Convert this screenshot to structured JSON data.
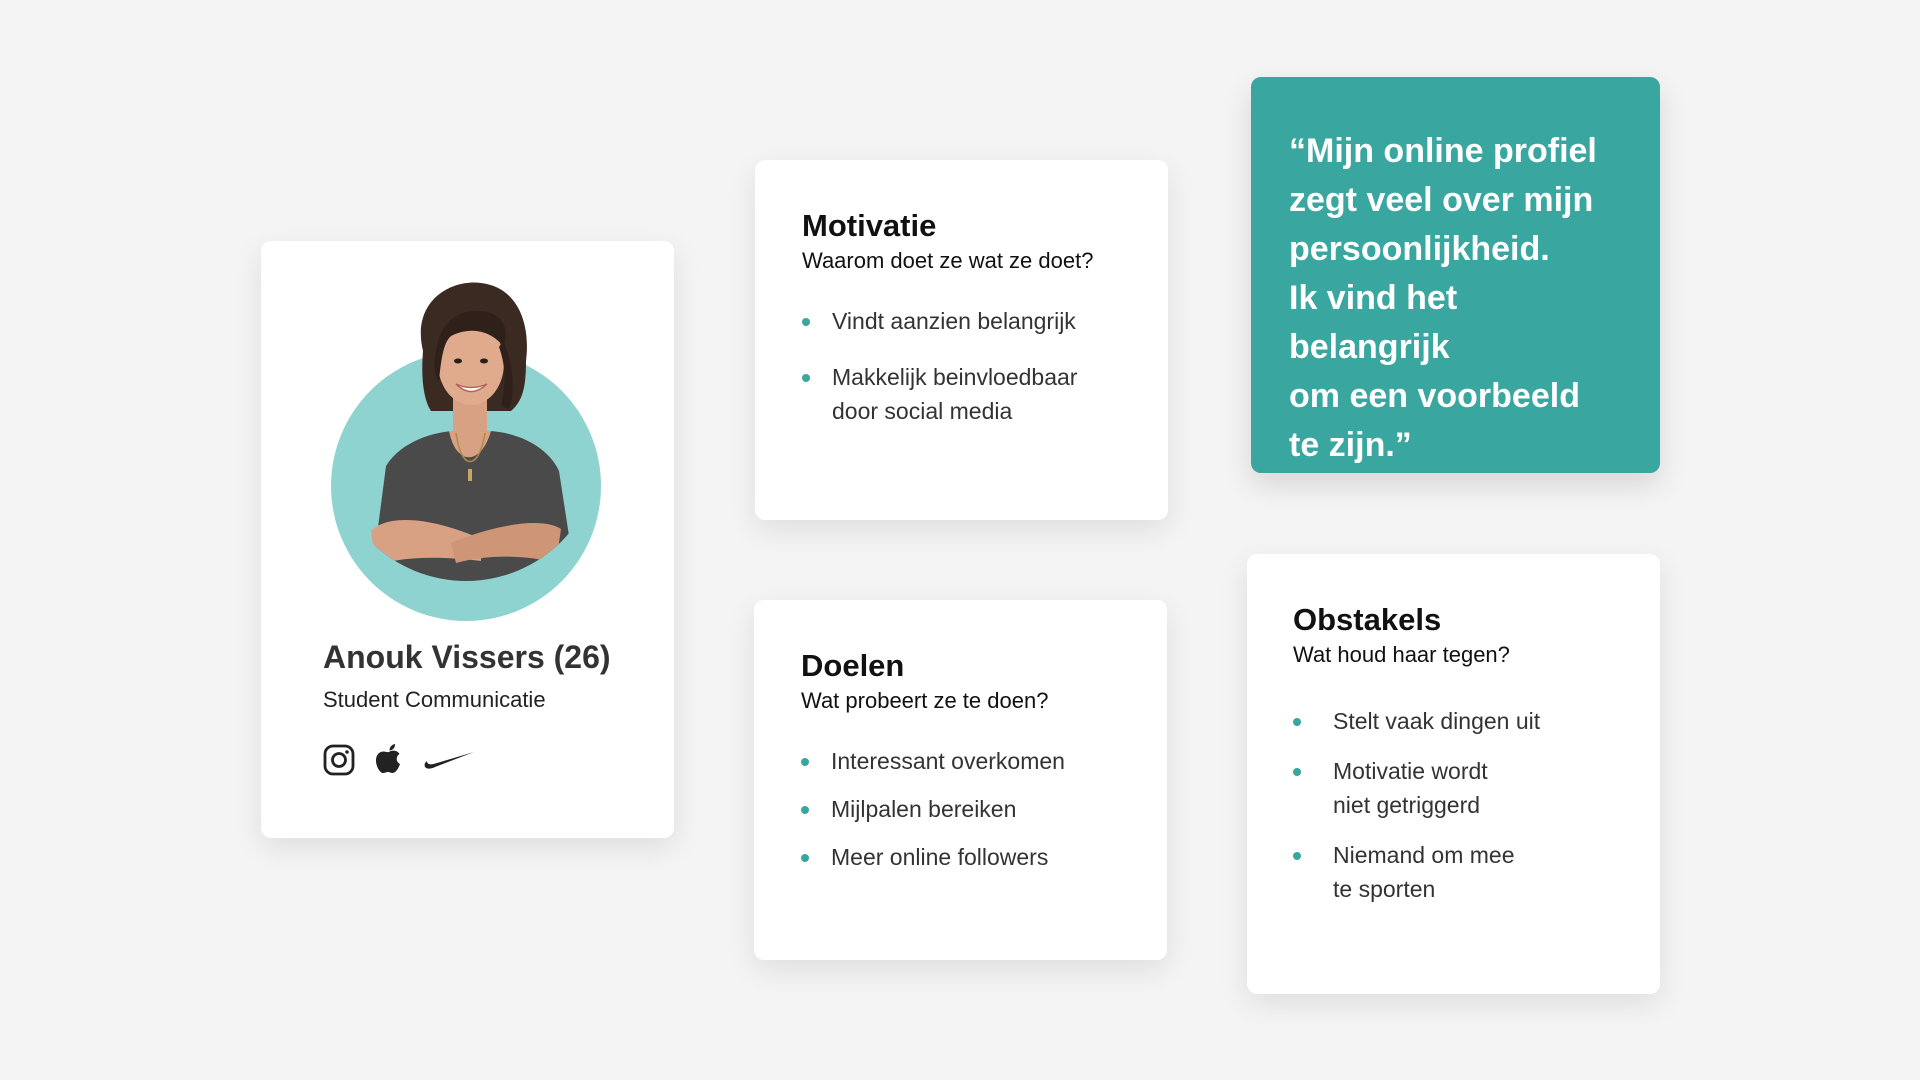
{
  "profile": {
    "name": "Anouk Vissers (26)",
    "role": "Student Communicatie",
    "brands": [
      {
        "icon": "instagram-icon"
      },
      {
        "icon": "apple-icon"
      },
      {
        "icon": "nike-icon"
      }
    ],
    "accent_color": "#8fd3d0"
  },
  "motivatie": {
    "title": "Motivatie",
    "subtitle": "Waarom doet ze wat ze doet?",
    "items": [
      "Vindt aanzien belangrijk",
      "Makkelijk beinvloedbaar\ndoor social media"
    ]
  },
  "doelen": {
    "title": "Doelen",
    "subtitle": "Wat probeert ze te doen?",
    "items": [
      "Interessant overkomen",
      "Mijlpalen bereiken",
      "Meer online followers"
    ]
  },
  "obstakels": {
    "title": "Obstakels",
    "subtitle": "Wat houd haar tegen?",
    "items": [
      "Stelt vaak dingen uit",
      "Motivatie wordt\nniet getriggerd",
      "Niemand om mee\nte sporten"
    ]
  },
  "quote": {
    "text": "“Mijn online profiel\nzegt veel over mijn\npersoonlijkheid.\nIk vind het belangrijk\nom een voorbeeld\nte zijn.”",
    "background": "#3aa6a0"
  }
}
